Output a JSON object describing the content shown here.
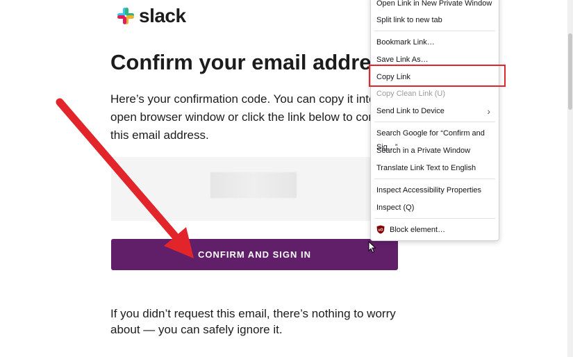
{
  "brand": {
    "name": "slack",
    "colors": [
      "#36c5f0",
      "#2eb67d",
      "#ecb22e",
      "#e01e5a"
    ]
  },
  "email": {
    "title": "Confirm your email addres",
    "intro_lines": [
      "Here’s your confirmation code. You can copy it into t",
      "open browser window or click the link below to confi",
      "this email address."
    ],
    "button_label": "CONFIRM AND SIGN IN",
    "outro_lines": [
      "If you didn’t request this email, there’s nothing to worry",
      "about — you can safely ignore it."
    ],
    "button_color": "#611f69"
  },
  "context_menu": {
    "items": {
      "open_private": "Open Link in New Private Window",
      "split_tab": "Split link to new tab",
      "bookmark": "Bookmark Link…",
      "save_as": "Save Link As…",
      "copy_link": "Copy Link",
      "copy_clean": "Copy Clean Link (U)",
      "send_device": "Send Link to Device",
      "search_google": "Search Google for “Confirm and Sig…”",
      "search_private": "Search in a Private Window",
      "translate": "Translate Link Text to English",
      "inspect_a11y": "Inspect Accessibility Properties",
      "inspect": "Inspect (Q)",
      "block_element": "Block element…"
    },
    "highlight_color": "#e2252b"
  },
  "annotation": {
    "arrow_color": "#e2252b"
  }
}
